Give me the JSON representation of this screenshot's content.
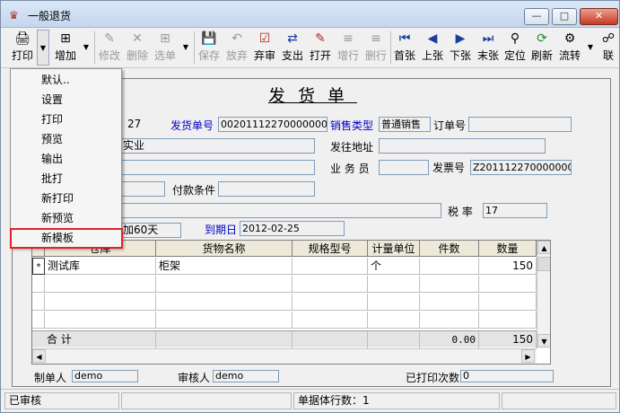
{
  "window": {
    "title": "一般退货"
  },
  "toolbar": {
    "buttons": [
      {
        "label": "打印",
        "icon": "printer-icon"
      },
      {
        "label": "增加",
        "icon": "add-icon"
      },
      {
        "label": "修改",
        "icon": "edit-icon"
      },
      {
        "label": "删除",
        "icon": "delete-icon"
      },
      {
        "label": "选单",
        "icon": "select-icon"
      },
      {
        "label": "保存",
        "icon": "save-icon"
      },
      {
        "label": "放弃",
        "icon": "undo-icon"
      },
      {
        "label": "弃审",
        "icon": "unapprove-icon"
      },
      {
        "label": "支出",
        "icon": "expense-icon"
      },
      {
        "label": "打开",
        "icon": "open-icon"
      },
      {
        "label": "增行",
        "icon": "add-row-icon"
      },
      {
        "label": "删行",
        "icon": "delete-row-icon"
      },
      {
        "label": "首张",
        "icon": "first-icon"
      },
      {
        "label": "上张",
        "icon": "prev-icon"
      },
      {
        "label": "下张",
        "icon": "next-icon"
      },
      {
        "label": "末张",
        "icon": "last-icon"
      },
      {
        "label": "定位",
        "icon": "locate-icon"
      },
      {
        "label": "刷新",
        "icon": "refresh-icon"
      },
      {
        "label": "流转",
        "icon": "flow-icon"
      },
      {
        "label": "联",
        "icon": "link-icon"
      }
    ]
  },
  "menu": {
    "items": [
      "默认..",
      "设置",
      "打印",
      "预览",
      "输出",
      "批打",
      "新打印",
      "新预览",
      "新模板"
    ]
  },
  "form": {
    "title": "发货单",
    "field_partial_27": "27",
    "ship_no_label": "发货单号",
    "ship_no": "00201112270000000006",
    "sale_type_label": "销售类型",
    "sale_type": "普通销售",
    "order_no_label": "订单号",
    "order_no": "",
    "customer_partial": "实业",
    "ship_addr_label": "发往地址",
    "ship_addr": "",
    "salesman_label": "业 务 员",
    "salesman": "",
    "invoice_no_label": "发票号",
    "invoice_no": "Z201112270000000005",
    "pay_terms_label": "付款条件",
    "pay_terms": "",
    "tax_label": "税 率",
    "tax_rate": "17",
    "terms_partial": "加60天",
    "due_label": "到期日",
    "due_date": "2012-02-25",
    "maker_label": "制单人",
    "maker": "demo",
    "reviewer_label": "审核人",
    "reviewer": "demo",
    "printed_label": "已打印次数",
    "printed": "0"
  },
  "grid": {
    "columns": [
      "仓库",
      "货物名称",
      "规格型号",
      "计量单位",
      "件数",
      "数量"
    ],
    "rows": [
      {
        "marker": "*",
        "warehouse": "测试库",
        "name": "柜架",
        "spec": "",
        "unit": "个",
        "pieces": "",
        "qty": "150"
      }
    ],
    "total_label": "合   计",
    "total_pieces": "0.00",
    "total_qty": "150"
  },
  "status": {
    "state": "已审核",
    "rows_label": "单据体行数：1"
  }
}
